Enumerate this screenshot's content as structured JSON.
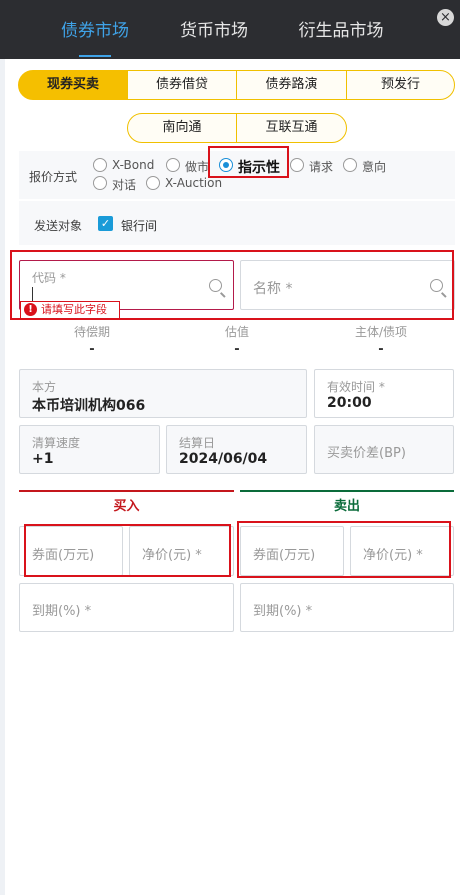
{
  "header": {
    "tabs": [
      {
        "label": "债券市场",
        "active": true
      },
      {
        "label": "货币市场",
        "active": false
      },
      {
        "label": "衍生品市场",
        "active": false
      }
    ],
    "close_glyph": "×"
  },
  "segments": {
    "row1": [
      "现券买卖",
      "债券借贷",
      "债券路演",
      "预发行"
    ],
    "row1_active": "现券买卖",
    "row2": [
      "南向通",
      "互联互通"
    ]
  },
  "quote": {
    "label": "报价方式",
    "options": [
      "X-Bond",
      "做市",
      "指示性",
      "请求",
      "意向",
      "对话",
      "X-Auction"
    ],
    "selected": "指示性"
  },
  "target": {
    "label": "发送对象",
    "checkbox_label": "银行间",
    "checked": true
  },
  "search": {
    "code_placeholder": "代码 *",
    "name_placeholder": "名称 *",
    "error": "请填写此字段",
    "error_icon": "!"
  },
  "info": [
    {
      "label": "待偿期",
      "value": "-"
    },
    {
      "label": "估值",
      "value": "-"
    },
    {
      "label": "主体/债项",
      "value": "-"
    }
  ],
  "fields": {
    "party_label": "本方",
    "party_value": "本币培训机构066",
    "valid_time_label": "有效时间 *",
    "valid_time_value": "20:00",
    "settle_speed_label": "清算速度",
    "settle_speed_value": "+1",
    "settle_date_label": "结算日",
    "settle_date_value": "2024/06/04",
    "spread_placeholder": "买卖价差(BP)"
  },
  "buy": {
    "title": "买入",
    "face_placeholder": "券面(万元)",
    "price_placeholder": "净价(元) *",
    "yield_placeholder": "到期(%) *",
    "color": "#c4161c"
  },
  "sell": {
    "title": "卖出",
    "face_placeholder": "券面(万元)",
    "price_placeholder": "净价(元) *",
    "yield_placeholder": "到期(%) *",
    "color": "#0a6b3a"
  }
}
